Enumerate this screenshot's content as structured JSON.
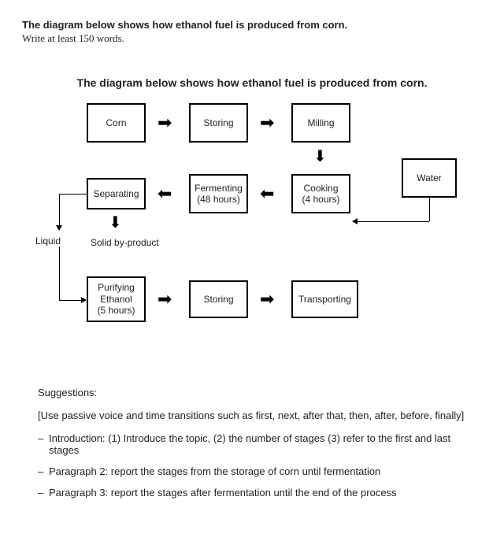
{
  "task": {
    "title": "The diagram below shows how ethanol fuel is produced from corn.",
    "instruction": "Write at least 150 words."
  },
  "diagram": {
    "title": "The diagram below shows how ethanol fuel is produced from corn.",
    "boxes": {
      "corn": "Corn",
      "storing1": "Storing",
      "milling": "Milling",
      "water": "Water",
      "cooking": "Cooking\n(4 hours)",
      "fermenting": "Fermenting\n(48 hours)",
      "separating": "Separating",
      "purifying": "Purifying\nEthanol\n(5 hours)",
      "storing2": "Storing",
      "transporting": "Transporting"
    },
    "labels": {
      "liquid": "Liquid",
      "solid": "Solid by-product"
    }
  },
  "suggestions": {
    "heading": "Suggestions:",
    "intro": "[Use passive voice and time transitions such as first, next, after that, then, after, before, finally]",
    "bullets": [
      "Introduction: (1) Introduce the topic, (2) the number of stages (3) refer to the first and last stages",
      "Paragraph 2: report the stages from the storage of corn until fermentation",
      "Paragraph 3: report the stages after fermentation until the end of the process"
    ]
  },
  "chart_data": {
    "type": "process-flow",
    "title": "How ethanol fuel is produced from corn",
    "nodes": [
      {
        "id": "corn",
        "label": "Corn"
      },
      {
        "id": "storing1",
        "label": "Storing"
      },
      {
        "id": "milling",
        "label": "Milling"
      },
      {
        "id": "water",
        "label": "Water"
      },
      {
        "id": "cooking",
        "label": "Cooking (4 hours)"
      },
      {
        "id": "fermenting",
        "label": "Fermenting (48 hours)"
      },
      {
        "id": "separating",
        "label": "Separating"
      },
      {
        "id": "liquid",
        "label": "Liquid",
        "type": "output-label"
      },
      {
        "id": "solid",
        "label": "Solid by-product",
        "type": "output-label"
      },
      {
        "id": "purifying",
        "label": "Purifying Ethanol (5 hours)"
      },
      {
        "id": "storing2",
        "label": "Storing"
      },
      {
        "id": "transporting",
        "label": "Transporting"
      }
    ],
    "edges": [
      {
        "from": "corn",
        "to": "storing1"
      },
      {
        "from": "storing1",
        "to": "milling"
      },
      {
        "from": "milling",
        "to": "cooking"
      },
      {
        "from": "water",
        "to": "cooking"
      },
      {
        "from": "cooking",
        "to": "fermenting"
      },
      {
        "from": "fermenting",
        "to": "separating"
      },
      {
        "from": "separating",
        "to": "liquid"
      },
      {
        "from": "separating",
        "to": "solid"
      },
      {
        "from": "liquid",
        "to": "purifying"
      },
      {
        "from": "purifying",
        "to": "storing2"
      },
      {
        "from": "storing2",
        "to": "transporting"
      }
    ]
  }
}
